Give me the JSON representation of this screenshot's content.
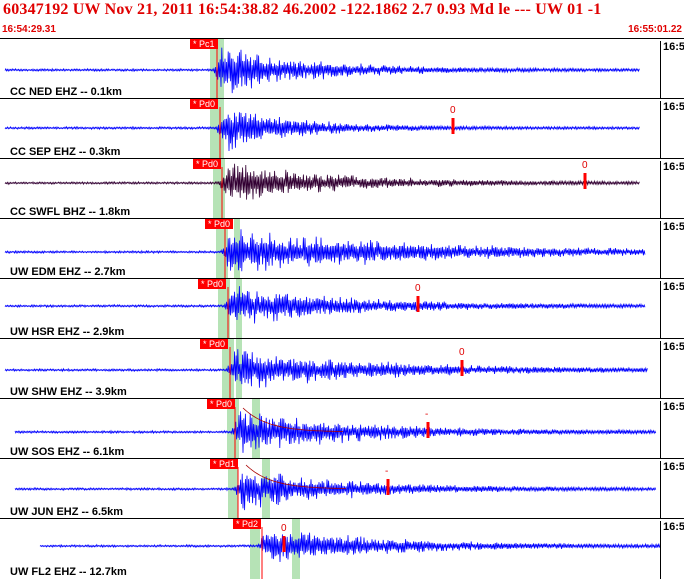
{
  "header": {
    "title": "60347192 UW Nov 21, 2011 16:54:38.82    46.2002 -122.1862  2.7 0.93 Md le --- UW 01   -1",
    "start_time": "16:54:29.31",
    "end_time": "16:55:01.22"
  },
  "colors": {
    "trace": "#0000ff",
    "trace_alt": "#330033",
    "pick": "#ff0000",
    "window": "#b6e3b6",
    "text_red": "#e00000"
  },
  "traces": [
    {
      "station": "CC NED EHZ -- 0.1km",
      "pick_label": "* Pc1",
      "time_label": "16:5",
      "coda_label": ""
    },
    {
      "station": "CC SEP EHZ -- 0.3km",
      "pick_label": "* Pd0",
      "time_label": "16:5",
      "coda_label": "0"
    },
    {
      "station": "CC SWFL BHZ -- 1.8km",
      "pick_label": "* Pd0",
      "time_label": "16:5",
      "coda_label": "0"
    },
    {
      "station": "UW EDM EHZ -- 2.7km",
      "pick_label": "* Pd0",
      "time_label": "16:5",
      "coda_label": ""
    },
    {
      "station": "UW HSR EHZ -- 2.9km",
      "pick_label": "* Pd0",
      "time_label": "16:5",
      "coda_label": "0"
    },
    {
      "station": "UW SHW EHZ -- 3.9km",
      "pick_label": "* Pd0",
      "time_label": "16:5",
      "coda_label": "0"
    },
    {
      "station": "UW SOS EHZ -- 6.1km",
      "pick_label": "* Pd0",
      "time_label": "16:5",
      "coda_label": "-"
    },
    {
      "station": "UW JUN EHZ -- 6.5km",
      "pick_label": "* Pd1",
      "time_label": "16:5",
      "coda_label": "-"
    },
    {
      "station": "UW FL2 EHZ -- 12.7km",
      "pick_label": "* Pd2",
      "time_label": "16:5",
      "coda_label": "0"
    }
  ]
}
